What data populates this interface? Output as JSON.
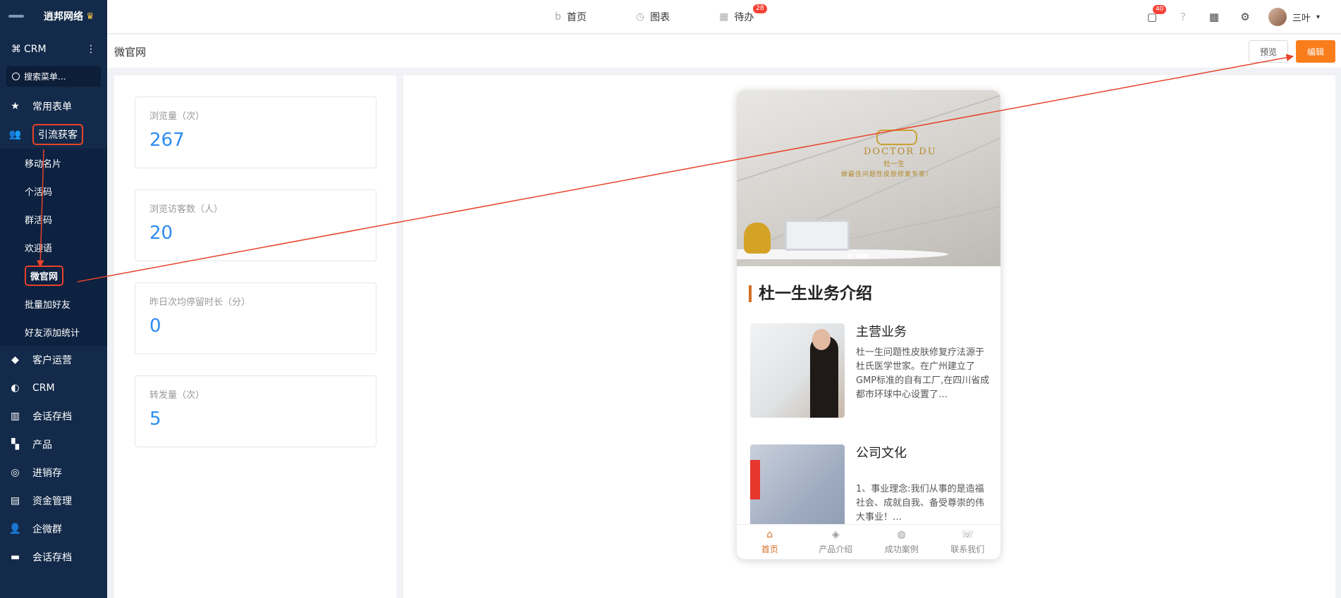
{
  "brand": {
    "name": "逍邦网络",
    "crown": "♛"
  },
  "crm_switch": {
    "label": "CRM"
  },
  "search": {
    "placeholder": "搜索菜单..."
  },
  "menu": {
    "common_forms": "常用表单",
    "lead_gen": "引流获客",
    "sub_items": [
      "移动名片",
      "个活码",
      "群活码",
      "欢迎语",
      "微官网",
      "批量加好友",
      "好友添加统计"
    ],
    "others": [
      "客户运营",
      "CRM",
      "会话存档",
      "产品",
      "进销存",
      "资金管理",
      "企微群",
      "会话存档"
    ]
  },
  "topnav": {
    "home": "首页",
    "charts": "图表",
    "todo": "待办",
    "todo_badge": "28"
  },
  "topright": {
    "msg_badge": "40",
    "user_name": "三叶"
  },
  "page": {
    "title": "微官网",
    "preview_btn": "预览",
    "edit_btn": "编辑"
  },
  "stats": [
    {
      "label": "浏览量（次）",
      "value": "267"
    },
    {
      "label": "浏览访客数（人）",
      "value": "20"
    },
    {
      "label": "昨日次均停留时长（分）",
      "value": "0"
    },
    {
      "label": "转发量（次）",
      "value": "5"
    }
  ],
  "phone": {
    "banner_brand": "DOCTOR DU",
    "banner_sub": "杜一生",
    "banner_slogan": "做最佳问题性皮肤修复专家!",
    "section_title": "杜一生业务介绍",
    "cards": [
      {
        "title": "主营业务",
        "desc": "杜一生问题性皮肤修复疗法源于杜氏医学世家。在广州建立了GMP标准的自有工厂,在四川省成都市环球中心设置了…"
      },
      {
        "title": "公司文化",
        "desc": "1、事业理念:我们从事的是造福社会、成就自我、备受尊崇的伟大事业！…"
      }
    ],
    "tabs": [
      "首页",
      "产品介绍",
      "成功案例",
      "联系我们"
    ]
  },
  "colors": {
    "sidebar": "#132a4a",
    "accent": "#fa7d1c",
    "stat_value": "#2d8cf0",
    "annotation": "#e8432a"
  }
}
